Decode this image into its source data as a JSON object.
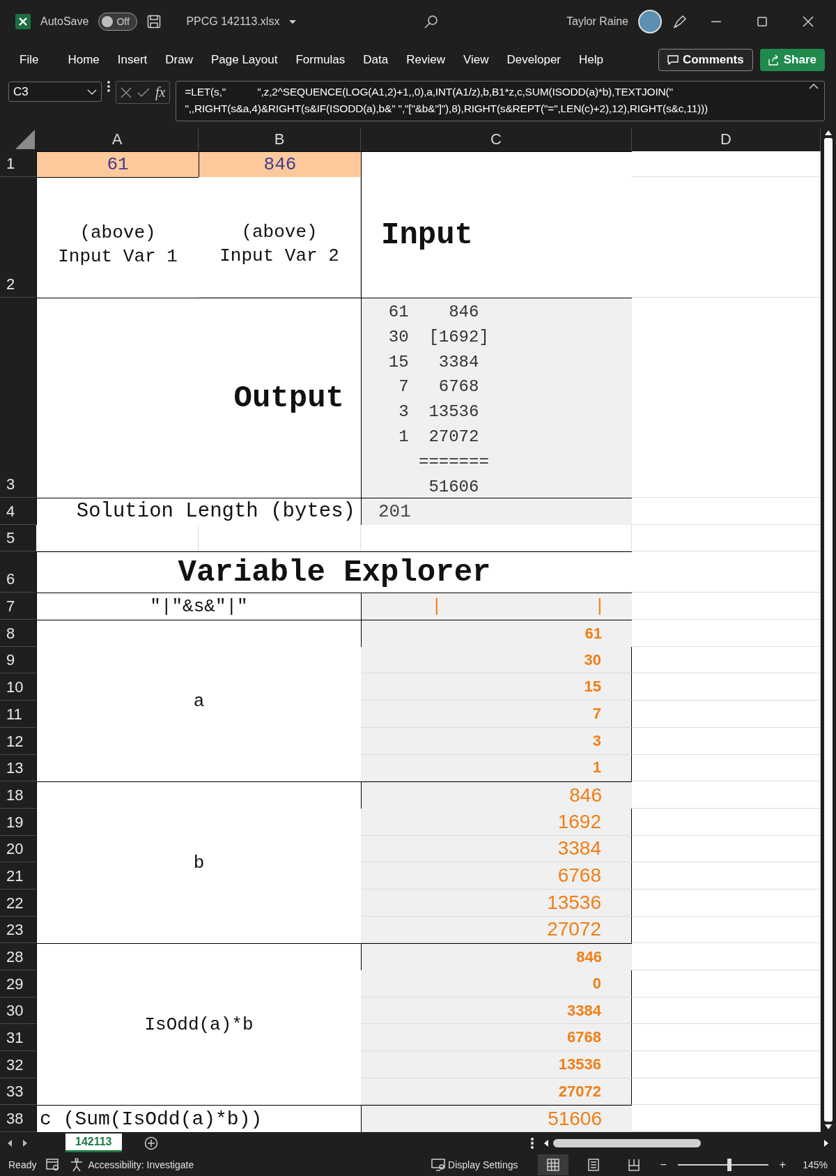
{
  "window": {
    "autosave_label": "AutoSave",
    "autosave_on": false,
    "autosave_state": "Off",
    "file_name": "PPCG 142113.xlsx",
    "user": "Taylor Raine"
  },
  "menu": [
    "File",
    "Home",
    "Insert",
    "Draw",
    "Page Layout",
    "Formulas",
    "Data",
    "Review",
    "View",
    "Developer",
    "Help"
  ],
  "comments_button": "Comments",
  "share_button": "Share",
  "formula_bar": {
    "name_box": "C3",
    "fx": "fx",
    "formula_lines": [
      "=LET(s,\"           \",z,2^SEQUENCE(LOG(A1,2)+1,,0),a,INT(A1/z),b,B1*z,c,SUM(ISODD(a)*b),TEXTJOIN(\"",
      "\",,RIGHT(s&a,4)&RIGHT(s&IF(ISODD(a),b&\" \",\"[\"&b&\"]\"),8),RIGHT(s&REPT(\"=\",LEN(c)+2),12),RIGHT(s&c,11)))"
    ]
  },
  "columns": [
    "A",
    "B",
    "C",
    "D"
  ],
  "row_headers": [
    "1",
    "2",
    "3",
    "4",
    "5",
    "6",
    "7",
    "8",
    "9",
    "10",
    "11",
    "12",
    "13",
    "18",
    "19",
    "20",
    "21",
    "22",
    "23",
    "28",
    "29",
    "30",
    "31",
    "32",
    "33",
    "38"
  ],
  "sheet": {
    "input_1": "61",
    "input_2": "846",
    "input_1_label": [
      "(above)",
      "Input Var 1"
    ],
    "input_2_label": [
      "(above)",
      "Input Var 2"
    ],
    "input_title": "Input",
    "output_title": "Output",
    "output_lines": [
      "  61    846 ",
      "  30  [1692]",
      "  15   3384 ",
      "   7   6768 ",
      "   3  13536 ",
      "   1  27072 ",
      "     =======",
      "      51606"
    ],
    "length_label": "Solution Length (bytes)",
    "length_value": "201",
    "explorer_title": "Variable Explorer",
    "s_label": "\"|\"&s&\"|\"",
    "s_value": "|              |",
    "groups": [
      {
        "label": "a",
        "kind": "bold",
        "values": [
          "61",
          "30",
          "15",
          "7",
          "3",
          "1"
        ]
      },
      {
        "label": "b",
        "kind": "plain",
        "values": [
          "846",
          "1692",
          "3384",
          "6768",
          "13536",
          "27072"
        ]
      },
      {
        "label": "IsOdd(a)*b",
        "kind": "bold",
        "values": [
          "846",
          "0",
          "3384",
          "6768",
          "13536",
          "27072"
        ]
      }
    ],
    "c_label": "c (Sum(IsOdd(a)*b))",
    "c_value": "51606"
  },
  "sheet_tabs": [
    {
      "label": "142113",
      "selected": true
    }
  ],
  "status_bar": {
    "ready": "Ready",
    "accessibility": "Accessibility: Investigate",
    "display_settings": "Display Settings",
    "views": [
      {
        "kind": "normal",
        "selected": true
      },
      {
        "kind": "page-layout",
        "selected": false
      },
      {
        "kind": "page-break",
        "selected": false
      }
    ],
    "zoom_minus": "−",
    "zoom_plus": "+",
    "zoom_slider": {
      "level": 0.57
    },
    "zoom": "145%"
  }
}
